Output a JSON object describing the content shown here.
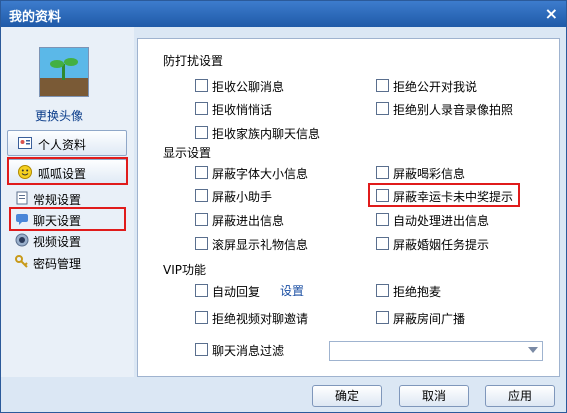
{
  "window": {
    "title": "我的资料",
    "close_label": "×"
  },
  "sidebar": {
    "change_avatar": "更换头像",
    "profile_button": "个人资料",
    "section_button": "呱呱设置",
    "items": [
      {
        "label": "常规设置",
        "icon": "document-icon"
      },
      {
        "label": "聊天设置",
        "icon": "chat-icon"
      },
      {
        "label": "视频设置",
        "icon": "camera-icon"
      },
      {
        "label": "密码管理",
        "icon": "key-icon"
      }
    ]
  },
  "sections": {
    "anti_disturb": {
      "title": "防打扰设置",
      "options": [
        "拒收公聊消息",
        "拒绝公开对我说",
        "拒收悄悄话",
        "拒绝别人录音录像拍照",
        "拒收家族内聊天信息"
      ]
    },
    "display": {
      "title": "显示设置",
      "options": [
        "屏蔽字体大小信息",
        "屏蔽喝彩信息",
        "屏蔽小助手",
        "屏蔽幸运卡未中奖提示",
        "屏蔽进出信息",
        "自动处理进出信息",
        "滚屏显示礼物信息",
        "屏蔽婚姻任务提示"
      ]
    },
    "vip": {
      "title": "VIP功能",
      "options": [
        "自动回复",
        "拒绝抱麦",
        "拒绝视频对聊邀请",
        "屏蔽房间广播",
        "聊天消息过滤"
      ],
      "settings_link": "设置",
      "filter_select_value": ""
    }
  },
  "buttons": {
    "ok": "确定",
    "cancel": "取消",
    "apply": "应用"
  },
  "colors": {
    "title_bar": "#2b66b8",
    "highlight_box": "#e01b1b",
    "link": "#1b4fa3"
  }
}
